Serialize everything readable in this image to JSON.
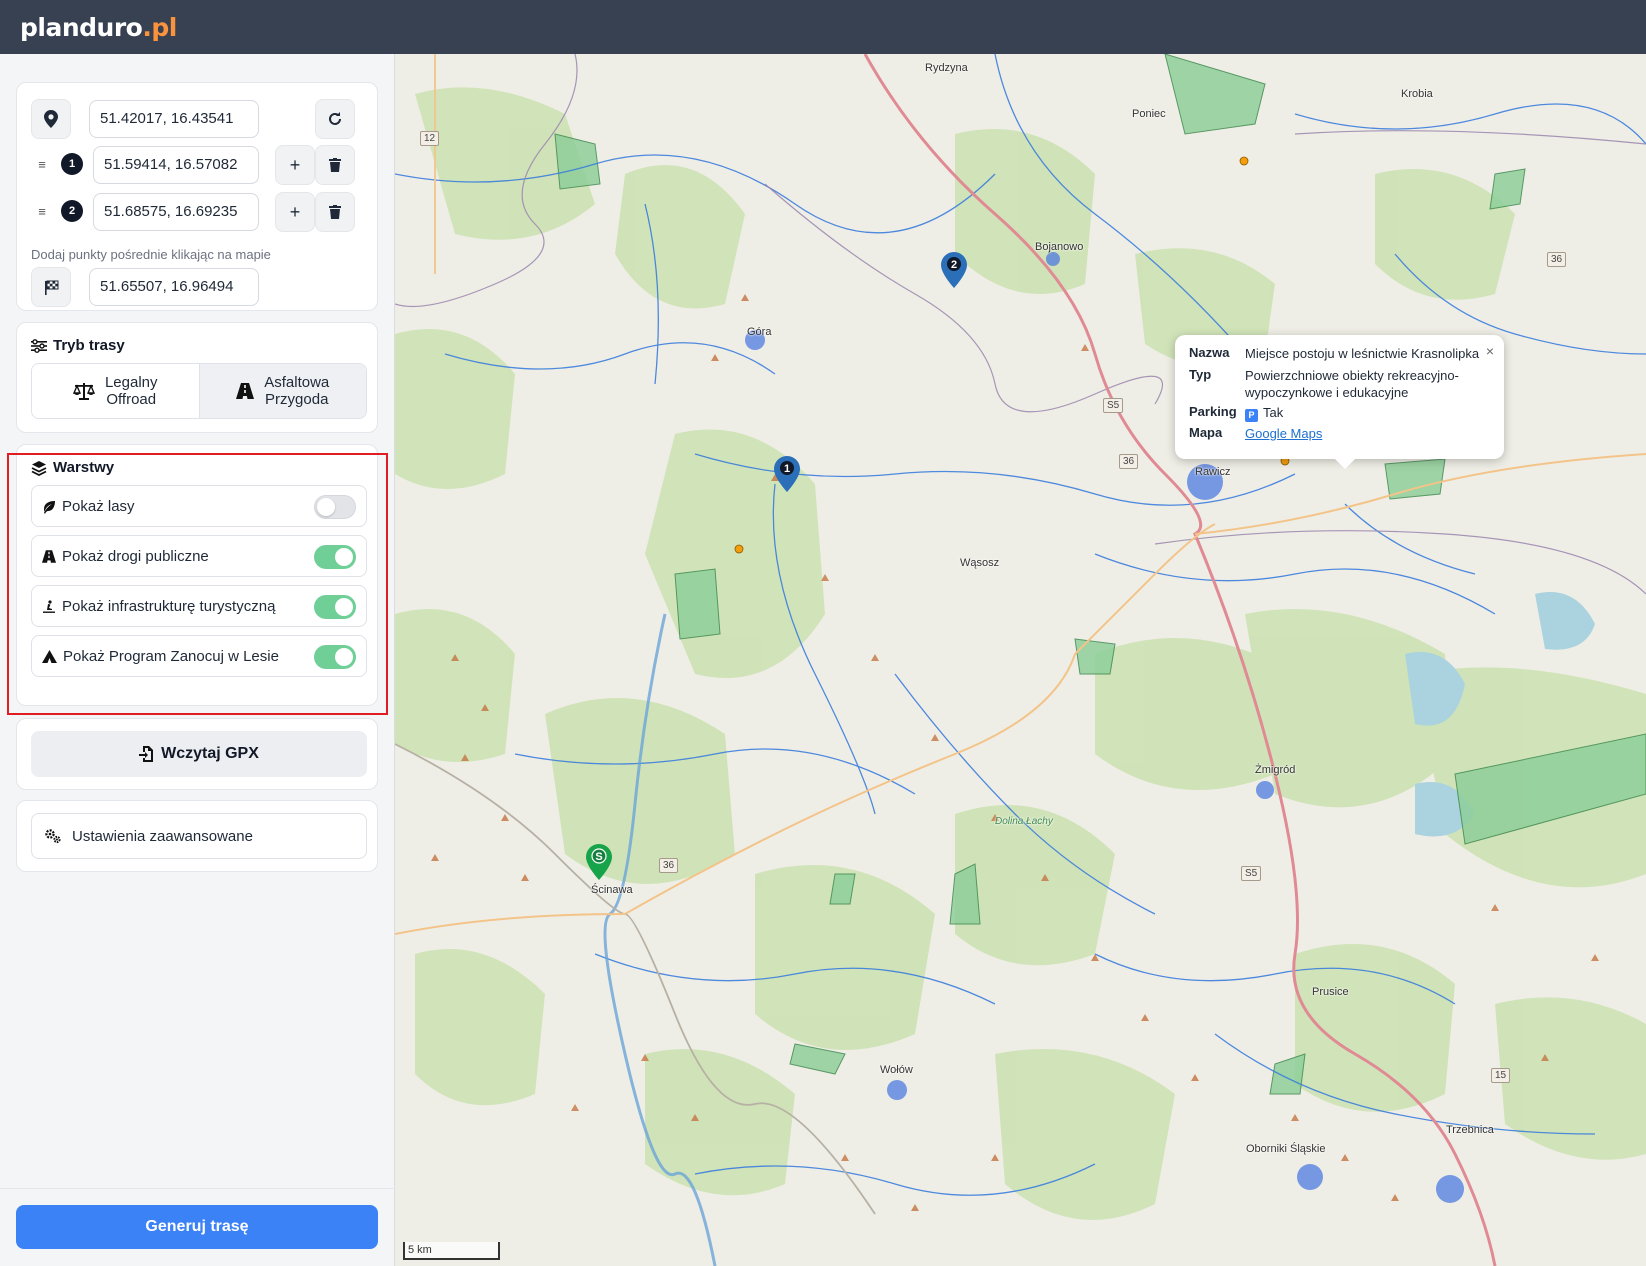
{
  "app": {
    "logo_main": "planduro",
    "logo_tld": ".pl"
  },
  "points": {
    "start": {
      "value": "51.42017, 16.43541"
    },
    "waypoints": [
      {
        "index": "1",
        "value": "51.59414, 16.57082"
      },
      {
        "index": "2",
        "value": "51.68575, 16.69235"
      }
    ],
    "hint": "Dodaj punkty pośrednie klikając na mapie",
    "end": {
      "value": "51.65507, 16.96494"
    }
  },
  "route_mode": {
    "title": "Tryb trasy",
    "options": [
      {
        "line1": "Legalny",
        "line2": "Offroad",
        "selected": true
      },
      {
        "line1": "Asfaltowa",
        "line2": "Przygoda",
        "selected": false
      }
    ]
  },
  "layers": {
    "title": "Warstwy",
    "items": [
      {
        "label": "Pokaż lasy",
        "icon": "leaf-icon",
        "on": false
      },
      {
        "label": "Pokaż drogi publiczne",
        "icon": "road-icon",
        "on": true
      },
      {
        "label": "Pokaż infrastrukturę turystyczną",
        "icon": "person-swimming-icon",
        "on": true
      },
      {
        "label": "Pokaż Program Zanocuj w Lesie",
        "icon": "tent-icon",
        "on": true
      }
    ]
  },
  "gpx_button": "Wczytaj GPX",
  "advanced_button": "Ustawienia zaawansowane",
  "generate_button": "Generuj trasę",
  "map": {
    "places": [
      {
        "name": "Rydzyna"
      },
      {
        "name": "Poniec"
      },
      {
        "name": "Krobia"
      },
      {
        "name": "Bojanowo"
      },
      {
        "name": "Góra"
      },
      {
        "name": "Rawicz"
      },
      {
        "name": "Wąsosz"
      },
      {
        "name": "Żmigród"
      },
      {
        "name": "Ścinawa"
      },
      {
        "name": "Wołów"
      },
      {
        "name": "Prusice"
      },
      {
        "name": "Oborniki Śląskie"
      },
      {
        "name": "Trzebnica"
      },
      {
        "name": "Dolina Łachy"
      }
    ],
    "road_numbers": [
      "12",
      "36",
      "36",
      "36",
      "S5",
      "S5",
      "15"
    ],
    "markers": [
      {
        "label": "2",
        "color": "#2a6fb8"
      },
      {
        "label": "1",
        "color": "#2a6fb8"
      },
      {
        "label": "S",
        "color": "#16a34a"
      }
    ],
    "popup": {
      "close": "×",
      "nazwa_key": "Nazwa",
      "nazwa": "Miejsce postoju w leśnictwie Krasnolipka",
      "typ_key": "Typ",
      "typ": "Powierzchniowe obiekty rekreacyjno-wypoczynkowe i edukacyjne",
      "parking_key": "Parking",
      "parking_badge": "P",
      "parking": "Tak",
      "mapa_key": "Mapa",
      "mapa": "Google Maps"
    },
    "scale": "5 km"
  },
  "colors": {
    "accent": "#3b82f6",
    "topbar": "#374151",
    "toggle_on": "#6fcf97",
    "highlight": "#e11d24"
  }
}
